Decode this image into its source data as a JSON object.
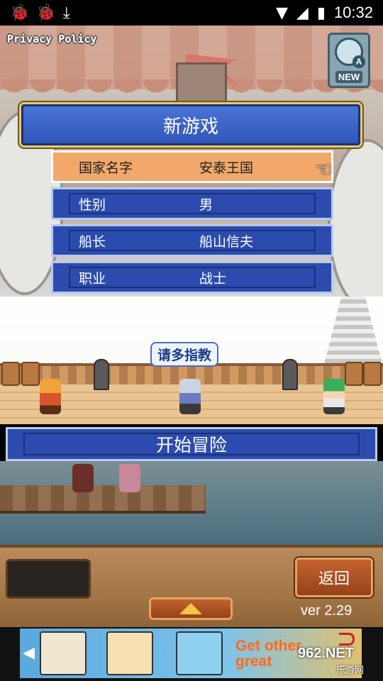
{
  "status_bar": {
    "left_icons": [
      "bug-icon",
      "bug-icon",
      "download-icon"
    ],
    "time": "10:32"
  },
  "top_links": {
    "privacy": "Privacy Policy",
    "new_badge": "NEW"
  },
  "menu": {
    "title": "新游戏",
    "rows": [
      {
        "label": "国家名字",
        "value": "安泰王国",
        "selected": true
      },
      {
        "label": "性别",
        "value": "男",
        "selected": false
      },
      {
        "label": "船长",
        "value": "船山信夫",
        "selected": false
      },
      {
        "label": "职业",
        "value": "战士",
        "selected": false
      }
    ]
  },
  "scene": {
    "speech": "请多指教"
  },
  "start_button": "开始冒险",
  "bottom": {
    "back_label": "返回",
    "version": "ver 2.29"
  },
  "ad": {
    "text_line1": "Get other",
    "text_line2": "great"
  },
  "watermark": {
    "brand": "962.NET",
    "sub": "乐游网"
  },
  "colors": {
    "menu_blue": "#2b4cae",
    "selected": "#f1a86a",
    "button_orange": "#c4622f"
  }
}
